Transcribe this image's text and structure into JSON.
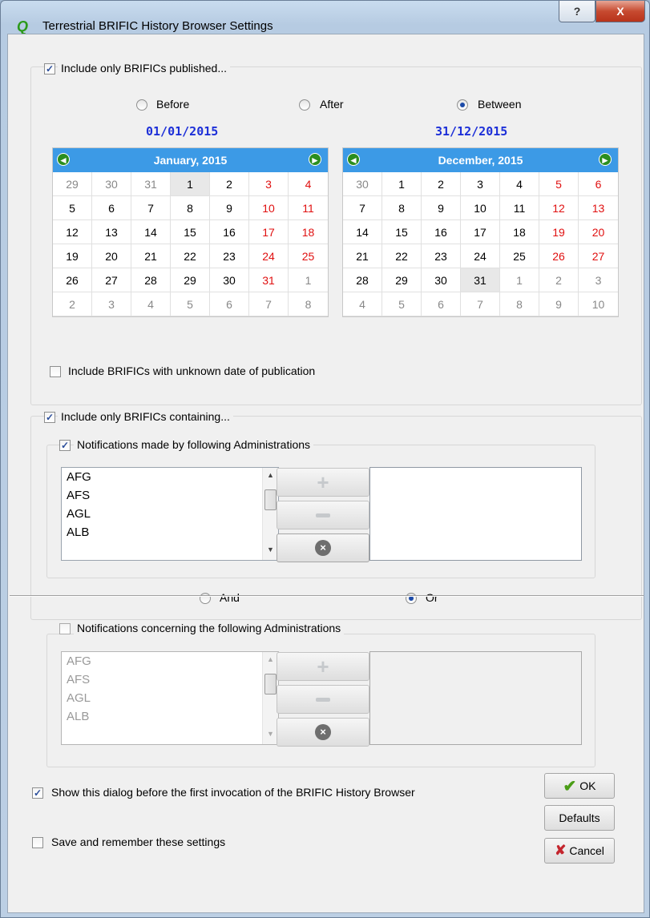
{
  "window": {
    "title": "Terrestrial BRIFIC History Browser Settings",
    "help_label": "?",
    "close_label": "X"
  },
  "published": {
    "label": "Include only BRIFICs published...",
    "checked": true,
    "options": {
      "before": "Before",
      "after": "After",
      "between": "Between"
    },
    "selected": "between",
    "start_date": "01/01/2015",
    "end_date": "31/12/2015",
    "unknown_label": "Include BRIFICs with unknown date of publication",
    "unknown_checked": false
  },
  "calendars": [
    {
      "month": "January,  2015",
      "selected_day": "1",
      "days": [
        [
          "29",
          "30",
          "31",
          "1",
          "2",
          "3",
          "4"
        ],
        [
          "5",
          "6",
          "7",
          "8",
          "9",
          "10",
          "11"
        ],
        [
          "12",
          "13",
          "14",
          "15",
          "16",
          "17",
          "18"
        ],
        [
          "19",
          "20",
          "21",
          "22",
          "23",
          "24",
          "25"
        ],
        [
          "26",
          "27",
          "28",
          "29",
          "30",
          "31",
          "1"
        ],
        [
          "2",
          "3",
          "4",
          "5",
          "6",
          "7",
          "8"
        ]
      ],
      "first_in_month": [
        0,
        3
      ],
      "last_in_month": [
        4,
        5
      ]
    },
    {
      "month": "December,  2015",
      "selected_day": "31",
      "days": [
        [
          "30",
          "1",
          "2",
          "3",
          "4",
          "5",
          "6"
        ],
        [
          "7",
          "8",
          "9",
          "10",
          "11",
          "12",
          "13"
        ],
        [
          "14",
          "15",
          "16",
          "17",
          "18",
          "19",
          "20"
        ],
        [
          "21",
          "22",
          "23",
          "24",
          "25",
          "26",
          "27"
        ],
        [
          "28",
          "29",
          "30",
          "31",
          "1",
          "2",
          "3"
        ],
        [
          "4",
          "5",
          "6",
          "7",
          "8",
          "9",
          "10"
        ]
      ],
      "first_in_month": [
        0,
        1
      ],
      "last_in_month": [
        4,
        3
      ]
    }
  ],
  "containing": {
    "label": "Include only BRIFICs containing...",
    "checked": true,
    "made_by": {
      "label": "Notifications made by following Administrations",
      "checked": true,
      "items": [
        "AFG",
        "AFS",
        "AGL",
        "ALB"
      ]
    },
    "logic": {
      "and": "And",
      "or": "Or",
      "selected": "or"
    },
    "concerning": {
      "label": "Notifications concerning the following Administrations",
      "checked": false,
      "items": [
        "AFG",
        "AFS",
        "AGL",
        "ALB"
      ]
    }
  },
  "footer": {
    "show_dialog_label": "Show this dialog before the first invocation of the BRIFIC History Browser",
    "show_dialog_checked": true,
    "save_label": "Save and remember these settings",
    "save_checked": false,
    "ok_label": "OK",
    "defaults_label": "Defaults",
    "cancel_label": "Cancel"
  },
  "icons": {
    "nav_left": "◄",
    "nav_right": "►",
    "check": "✓",
    "ok": "✔",
    "cancel": "✘"
  }
}
